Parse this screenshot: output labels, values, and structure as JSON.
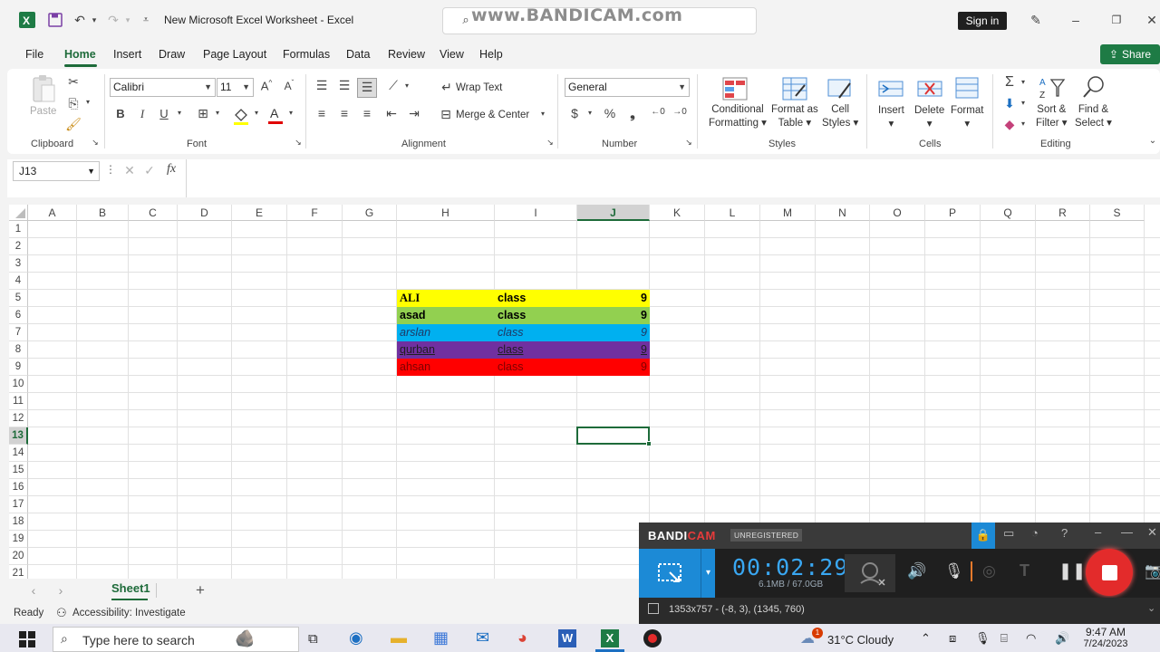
{
  "titlebar": {
    "doc_title": "New Microsoft Excel Worksheet  -  Excel",
    "watermark": "www.BANDICAM.com",
    "signin": "Sign in"
  },
  "tabs": [
    "File",
    "Home",
    "Insert",
    "Draw",
    "Page Layout",
    "Formulas",
    "Data",
    "Review",
    "View",
    "Help"
  ],
  "active_tab": "Home",
  "share_label": "Share",
  "ribbon": {
    "paste": "Paste",
    "clipboard": "Clipboard",
    "font_name": "Calibri",
    "font_size": "11",
    "font": "Font",
    "bold": "B",
    "italic": "I",
    "underline": "U",
    "wrap_text": "Wrap Text",
    "merge_center": "Merge & Center",
    "alignment": "Alignment",
    "number_format": "General",
    "number": "Number",
    "conditional_formatting_1": "Conditional",
    "conditional_formatting_2": "Formatting",
    "format_as_table_1": "Format as",
    "format_as_table_2": "Table",
    "cell_styles_1": "Cell",
    "cell_styles_2": "Styles",
    "styles": "Styles",
    "insert": "Insert",
    "delete": "Delete",
    "format": "Format",
    "cells": "Cells",
    "sort_filter_1": "Sort &",
    "sort_filter_2": "Filter",
    "find_select_1": "Find &",
    "find_select_2": "Select",
    "editing": "Editing"
  },
  "formula_bar": {
    "name_box": "J13",
    "fx": "fx",
    "content": ""
  },
  "columns": [
    "A",
    "B",
    "C",
    "D",
    "E",
    "F",
    "G",
    "H",
    "I",
    "J",
    "K",
    "L",
    "M",
    "N",
    "O",
    "P",
    "Q",
    "R",
    "S"
  ],
  "rows": [
    "1",
    "2",
    "3",
    "4",
    "5",
    "6",
    "7",
    "8",
    "9",
    "10",
    "11",
    "12",
    "13",
    "14",
    "15",
    "16",
    "17",
    "18",
    "19",
    "20",
    "21"
  ],
  "selected_column": "J",
  "selected_row": "13",
  "table": [
    {
      "name": "ALI",
      "cls": "class",
      "val": "9",
      "bg": "#ffff00",
      "fg": "#000000"
    },
    {
      "name": "asad",
      "cls": "class",
      "val": "9",
      "bg": "#92d050",
      "fg": "#000000"
    },
    {
      "name": "arslan",
      "cls": "class",
      "val": "9",
      "bg": "#00b0f0",
      "fg": "#1f3864"
    },
    {
      "name": "qurban",
      "cls": "class",
      "val": "9",
      "bg": "#7030a0",
      "fg": "#1f1f1f"
    },
    {
      "name": "ahsan",
      "cls": "class",
      "val": "9",
      "bg": "#ff0000",
      "fg": "#7f0000"
    }
  ],
  "sheet_tab": "Sheet1",
  "status": {
    "ready": "Ready",
    "accessibility": "Accessibility: Investigate"
  },
  "bandicam": {
    "logo_a": "BANDI",
    "logo_b": "CAM",
    "unregistered": "UNREGISTERED",
    "time": "00:02:29",
    "size": "6.1MB / 67.0GB",
    "info": "1353x757 - (-8, 3), (1345, 760)"
  },
  "taskbar": {
    "search_placeholder": "Type here to search",
    "weather": "31°C  Cloudy",
    "time": "9:47 AM",
    "date": "7/24/2023",
    "notif_count": "1"
  }
}
